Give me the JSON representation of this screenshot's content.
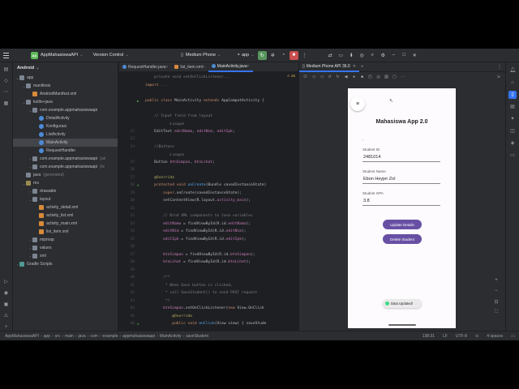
{
  "titlebar": {
    "project": "AppMahasiswaAPI",
    "project_badge": "AA",
    "vcs": "Version Control",
    "device": "Medium Phone",
    "run_config": "app"
  },
  "project_panel": {
    "header": "Android",
    "tree": [
      {
        "label": "app",
        "depth": 0,
        "icon": "folder",
        "expand": "open"
      },
      {
        "label": "manifests",
        "depth": 1,
        "icon": "folder",
        "expand": "open"
      },
      {
        "label": "AndroidManifest.xml",
        "depth": 2,
        "icon": "xml",
        "expand": ""
      },
      {
        "label": "kotlin+java",
        "depth": 1,
        "icon": "folder",
        "expand": "open"
      },
      {
        "label": "com.example.appmahasiswaapi",
        "depth": 2,
        "icon": "folder",
        "expand": "open"
      },
      {
        "label": "DetailActivity",
        "depth": 3,
        "icon": "java",
        "expand": ""
      },
      {
        "label": "Konfigurasi",
        "depth": 3,
        "icon": "java",
        "expand": ""
      },
      {
        "label": "ListActivity",
        "depth": 3,
        "icon": "java",
        "expand": ""
      },
      {
        "label": "MainActivity",
        "depth": 3,
        "icon": "java",
        "expand": "",
        "selected": true
      },
      {
        "label": "RequestHandler",
        "depth": 3,
        "icon": "java",
        "expand": ""
      },
      {
        "label": "com.example.appmahasiswaapi",
        "suffix": "(an",
        "depth": 2,
        "icon": "folder",
        "expand": "closed"
      },
      {
        "label": "com.example.appmahasiswaapi",
        "suffix": "(te",
        "depth": 2,
        "icon": "folder",
        "expand": "closed"
      },
      {
        "label": "java",
        "suffix": "(generated)",
        "depth": 1,
        "icon": "folder",
        "expand": ""
      },
      {
        "label": "res",
        "depth": 1,
        "icon": "res",
        "expand": "open"
      },
      {
        "label": "drawable",
        "depth": 2,
        "icon": "folder",
        "expand": "closed"
      },
      {
        "label": "layout",
        "depth": 2,
        "icon": "folder",
        "expand": "open"
      },
      {
        "label": "activity_detail.xml",
        "depth": 3,
        "icon": "xml",
        "expand": ""
      },
      {
        "label": "activity_list.xml",
        "depth": 3,
        "icon": "xml",
        "expand": ""
      },
      {
        "label": "activity_main.xml",
        "depth": 3,
        "icon": "xml",
        "expand": ""
      },
      {
        "label": "list_item.xml",
        "depth": 3,
        "icon": "xml",
        "expand": ""
      },
      {
        "label": "mipmap",
        "depth": 2,
        "icon": "folder",
        "expand": "closed"
      },
      {
        "label": "values",
        "depth": 2,
        "icon": "folder",
        "expand": "closed"
      },
      {
        "label": "xml",
        "depth": 2,
        "icon": "folder",
        "expand": "closed"
      },
      {
        "label": "Gradle Scripts",
        "depth": 0,
        "icon": "gradle",
        "expand": "closed"
      }
    ]
  },
  "editor": {
    "tabs": [
      {
        "label": "RequestHandler.java",
        "icon": "java",
        "active": false
      },
      {
        "label": "list_item.xml",
        "icon": "xml",
        "active": false
      },
      {
        "label": "MainActivity.java",
        "icon": "java",
        "active": true
      }
    ],
    "inspection_count": "26",
    "lines": [
      {
        "n": "",
        "segs": [
          [
            "cm",
            "    private void setOnClickListener..."
          ]
        ]
      },
      {
        "n": "",
        "segs": [
          [
            "kw",
            "import "
          ],
          [
            "cm",
            "..."
          ]
        ]
      },
      {
        "n": "",
        "segs": []
      },
      {
        "n": "",
        "g": "run",
        "segs": [
          [
            "kw",
            "public class "
          ],
          [
            "ctext",
            "MainActivity "
          ],
          [
            "kw",
            "extends "
          ],
          [
            "ctext",
            "AppCompatActivity {"
          ]
        ]
      },
      {
        "n": "",
        "segs": []
      },
      {
        "n": "",
        "segs": [
          [
            "cm",
            "    // Input field from layout"
          ]
        ]
      },
      {
        "n": "",
        "hint": "3 usages",
        "segs": []
      },
      {
        "n": "22",
        "segs": [
          [
            "ctext",
            "    EditText "
          ],
          [
            "fld",
            "editNama"
          ],
          [
            "ctext",
            ", "
          ],
          [
            "fld",
            "editNim"
          ],
          [
            "ctext",
            ", "
          ],
          [
            "fld",
            "editIpk"
          ],
          [
            "ctext",
            ";"
          ]
        ]
      },
      {
        "n": "23",
        "segs": []
      },
      {
        "n": "24",
        "segs": [
          [
            "cm",
            "    //Buttons"
          ]
        ]
      },
      {
        "n": "",
        "hint": "2 usages",
        "segs": []
      },
      {
        "n": "25",
        "segs": [
          [
            "ctext",
            "    Button "
          ],
          [
            "fld",
            "btnSimpan"
          ],
          [
            "ctext",
            ", "
          ],
          [
            "fld",
            "btnLihat"
          ],
          [
            "ctext",
            ";"
          ]
        ]
      },
      {
        "n": "26",
        "segs": []
      },
      {
        "n": "27",
        "segs": [
          [
            "an",
            "    @Override"
          ]
        ]
      },
      {
        "n": "28",
        "g": "ovr",
        "segs": [
          [
            "kw",
            "    protected void "
          ],
          [
            "fn",
            "onCreate"
          ],
          [
            "ctext",
            "(Bundle savedInstanceState)"
          ]
        ]
      },
      {
        "n": "29",
        "segs": [
          [
            "kw",
            "        super"
          ],
          [
            "ctext",
            ".onCreate(savedInstanceState);"
          ]
        ]
      },
      {
        "n": "30",
        "segs": [
          [
            "ctext",
            "        setContentView(R.layout."
          ],
          [
            "fld",
            "activity_main"
          ],
          [
            "ctext",
            ");"
          ]
        ]
      },
      {
        "n": "31",
        "segs": []
      },
      {
        "n": "32",
        "segs": [
          [
            "cm",
            "        // Bind XML components to Java variables"
          ]
        ]
      },
      {
        "n": "33",
        "segs": [
          [
            "fld",
            "        editNama"
          ],
          [
            "ctext",
            " = findViewById(R.id."
          ],
          [
            "fld",
            "editNama"
          ],
          [
            "ctext",
            ");"
          ]
        ]
      },
      {
        "n": "34",
        "segs": [
          [
            "fld",
            "        editNim"
          ],
          [
            "ctext",
            " = findViewById(R.id."
          ],
          [
            "fld",
            "editNim"
          ],
          [
            "ctext",
            ");"
          ]
        ]
      },
      {
        "n": "35",
        "segs": [
          [
            "fld",
            "        editIpk"
          ],
          [
            "ctext",
            " = findViewById(R.id."
          ],
          [
            "fld",
            "editIpk"
          ],
          [
            "ctext",
            ");"
          ]
        ]
      },
      {
        "n": "36",
        "segs": []
      },
      {
        "n": "37",
        "segs": [
          [
            "fld",
            "        btnSimpan"
          ],
          [
            "ctext",
            " = findViewById(R.id."
          ],
          [
            "fld",
            "btnSimpan"
          ],
          [
            "ctext",
            ");"
          ]
        ]
      },
      {
        "n": "38",
        "segs": [
          [
            "fld",
            "        btnLihat"
          ],
          [
            "ctext",
            " = findViewById(R.id."
          ],
          [
            "fld",
            "btnLihat"
          ],
          [
            "ctext",
            ");"
          ]
        ]
      },
      {
        "n": "39",
        "segs": []
      },
      {
        "n": "40",
        "segs": [
          [
            "cm",
            "        /**"
          ]
        ]
      },
      {
        "n": "41",
        "segs": [
          [
            "cm",
            "         * When Save button is clicked,"
          ]
        ]
      },
      {
        "n": "42",
        "segs": [
          [
            "cm",
            "         * call SaveStudent() to send POST request"
          ]
        ]
      },
      {
        "n": "43",
        "segs": [
          [
            "cm",
            "         */"
          ]
        ]
      },
      {
        "n": "44",
        "segs": [
          [
            "fld",
            "        btnSimpan"
          ],
          [
            "ctext",
            ".setOnClickListener("
          ],
          [
            "kw",
            "new "
          ],
          [
            "ctext",
            "View.OnClick"
          ]
        ]
      },
      {
        "n": "45",
        "segs": [
          [
            "an",
            "            @Override"
          ]
        ]
      },
      {
        "n": "46",
        "g": "ovr",
        "segs": [
          [
            "kw",
            "            public void "
          ],
          [
            "fn",
            "onClick"
          ],
          [
            "ctext",
            "(View view) "
          ],
          [
            "ctext",
            "{ saveStude"
          ]
        ]
      }
    ]
  },
  "emulator": {
    "tab_label": "Medium Phone API 36.0",
    "app": {
      "title": "Mahasiswa App 2.0",
      "fields": [
        {
          "label": "Student ID",
          "value": "2481014"
        },
        {
          "label": "Student Name",
          "value": "Ebon Heyjer Zol"
        },
        {
          "label": "Student GPA",
          "value": "3.8"
        }
      ],
      "buttons": [
        "Update Details",
        "Delete Student"
      ],
      "toast": "Data Updated!"
    }
  },
  "statusbar": {
    "crumbs": [
      "AppMahasiswaAPI",
      "app",
      "src",
      "main",
      "java",
      "com",
      "example",
      "appmahasiswaapi",
      "MainActivity",
      "saveStudent"
    ],
    "position": "138:31",
    "line_sep": "LF",
    "encoding": "UTF-8",
    "indent": "4 spaces"
  }
}
